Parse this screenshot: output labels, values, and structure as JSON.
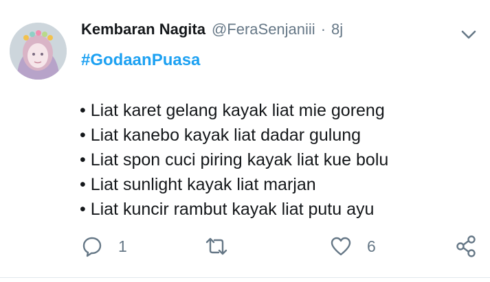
{
  "tweet": {
    "author_name": "Kembaran Nagita",
    "handle": "@FeraSenjaniii",
    "separator": "·",
    "time": "8j",
    "hashtag": "#GodaanPuasa",
    "lines": [
      "• Liat karet gelang kayak liat mie goreng",
      "• Liat kanebo kayak liat dadar gulung",
      "• Liat spon cuci piring kayak liat kue bolu",
      "• Liat sunlight kayak liat marjan",
      "• Liat kuncir rambut kayak liat putu ayu"
    ]
  },
  "actions": {
    "reply_count": "1",
    "retweet_count": "",
    "like_count": "6"
  },
  "icons": {
    "menu": "chevron-down-icon",
    "reply": "reply-icon",
    "retweet": "retweet-icon",
    "like": "heart-icon",
    "share": "share-icon"
  },
  "colors": {
    "accent": "#1da1f2",
    "muted": "#657786",
    "text": "#14171a"
  }
}
